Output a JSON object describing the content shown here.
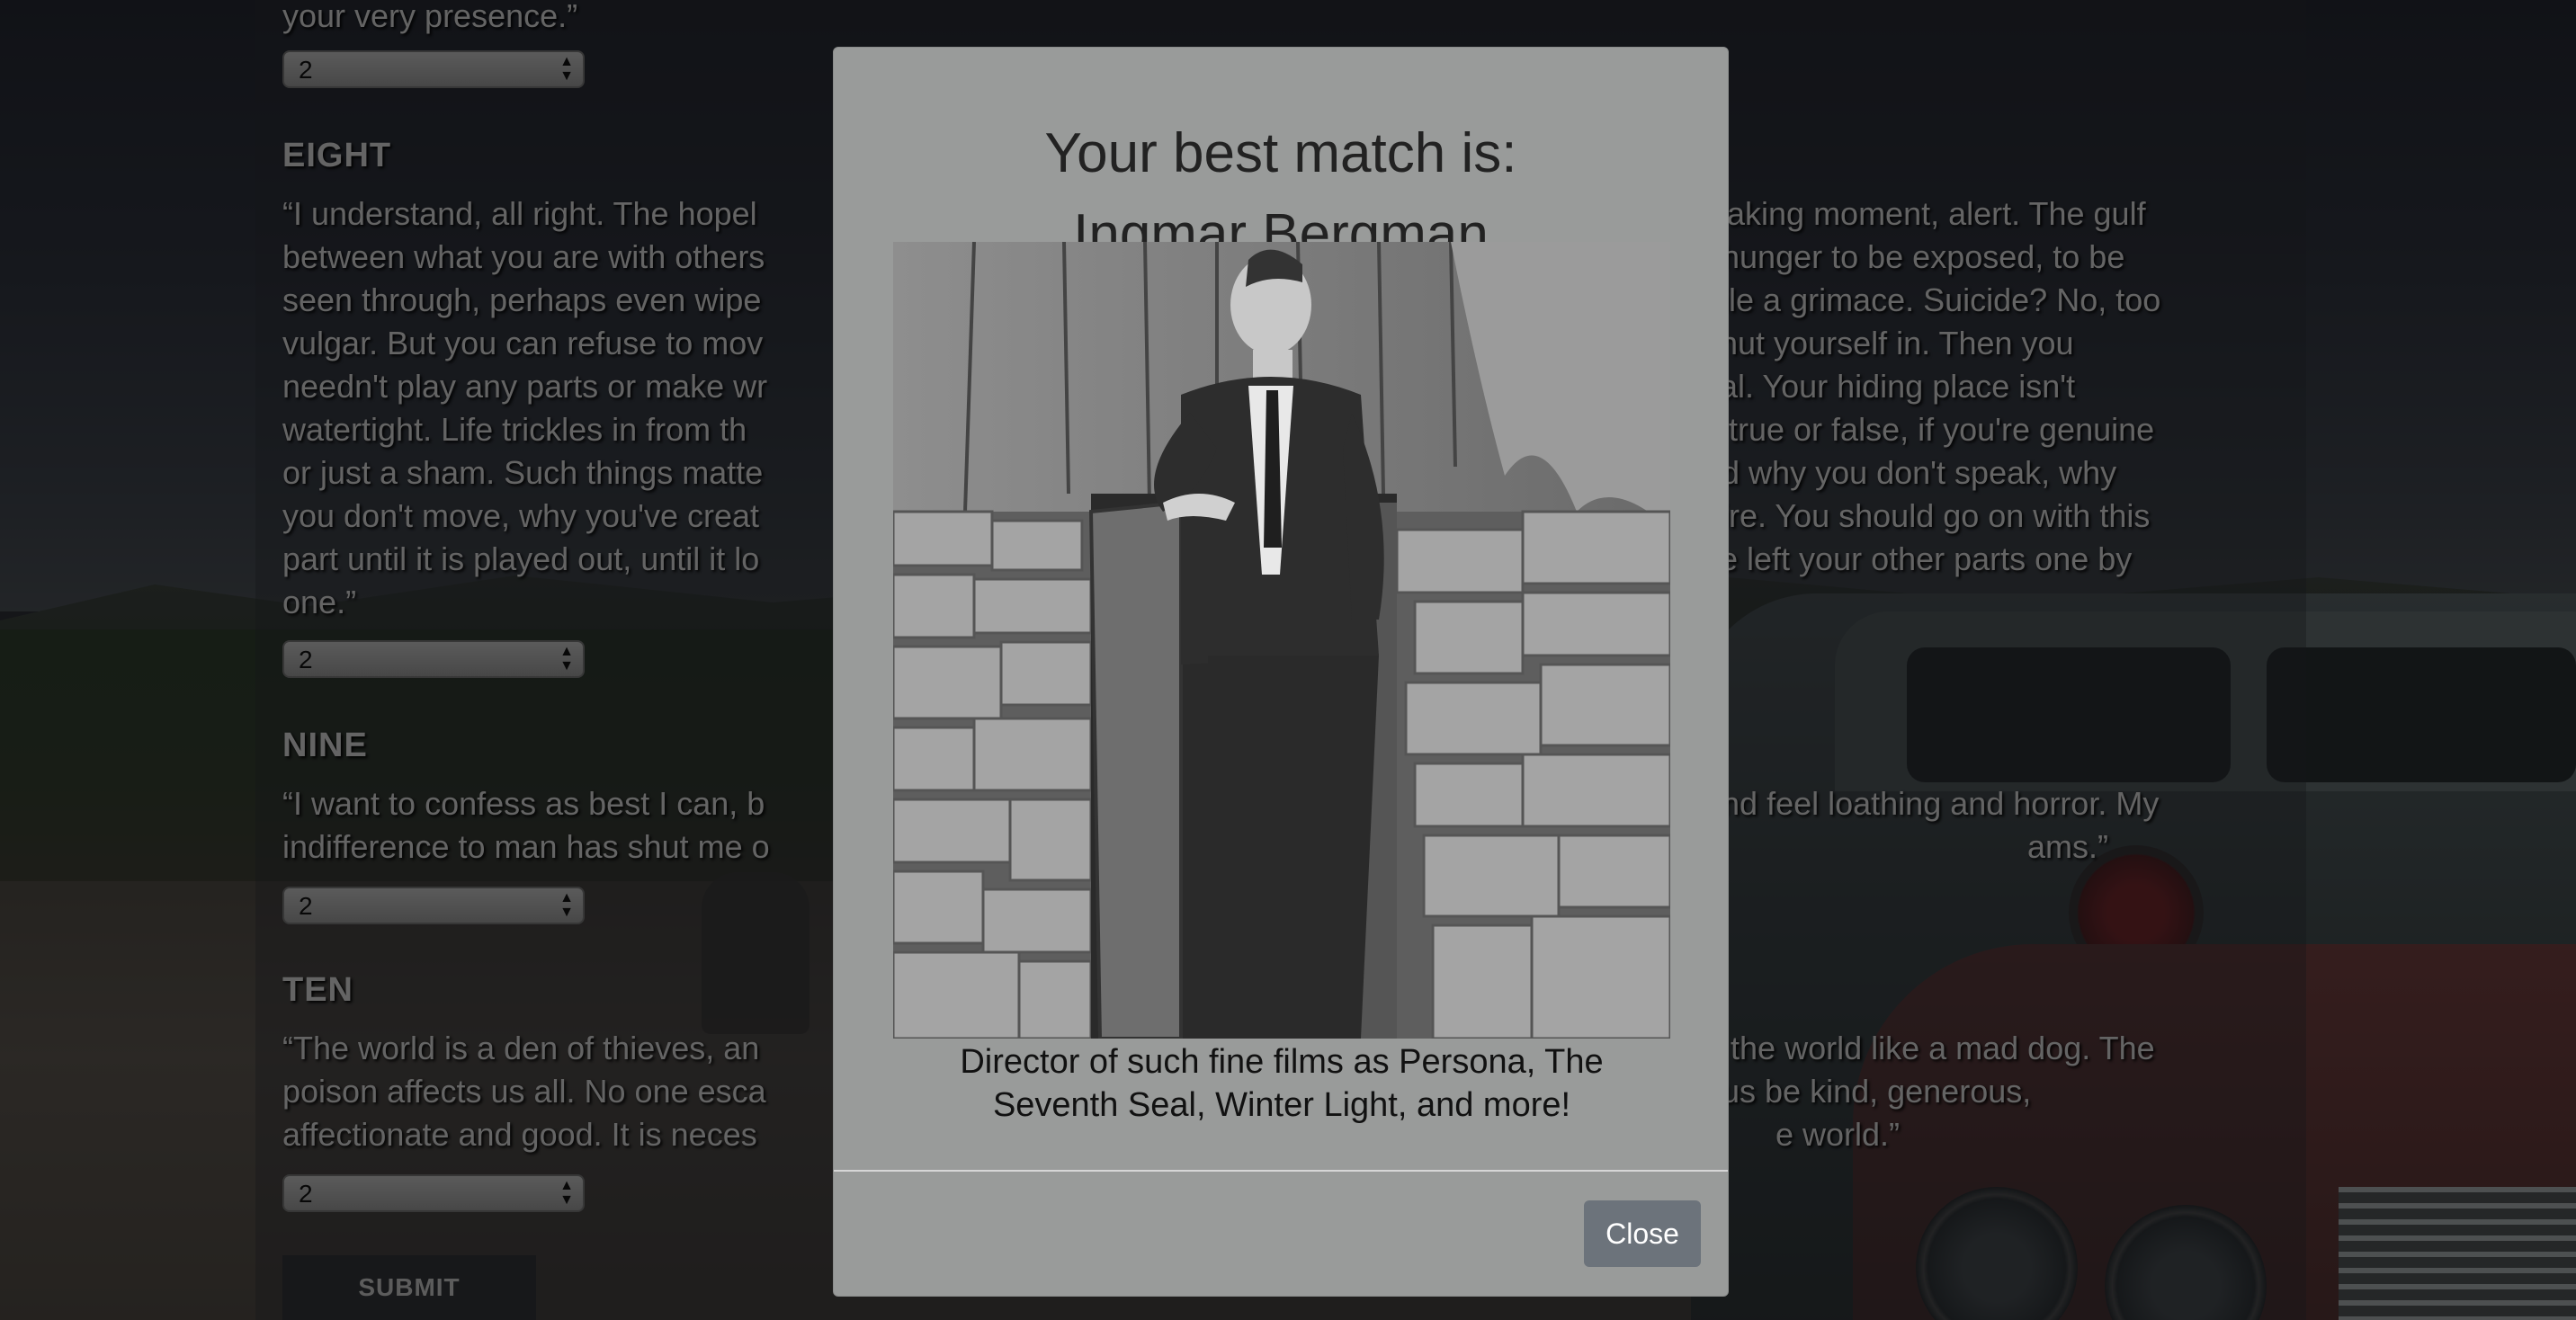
{
  "page": {
    "questions": [
      {
        "label": "",
        "text": "your very presence.”",
        "selected": "2"
      },
      {
        "label": "EIGHT",
        "text_visible": [
          "“I understand, all right. The hopel",
          "between what you are with others",
          "seen through, perhaps even wipe",
          "vulgar. But you can refuse to mov",
          "needn't play any parts or make wr",
          "watertight. Life trickles in from th",
          "or just a sham. Such things matte",
          "you don't move, why you've creat",
          "part until it is played out, until it lo",
          "one.”"
        ],
        "text_right": [
          "waking moment, alert. The gulf",
          "t hunger to be exposed, to be",
          "hile a grimace. Suicide? No, too",
          "shut yourself in. Then you",
          "cal. Your hiding place isn't",
          "s true or false, if you're genuine",
          "nd why you don't speak, why",
          "nire. You should go on with this",
          "ve left your other parts one by",
          ""
        ],
        "selected": "2"
      },
      {
        "label": "NINE",
        "text_visible": [
          "“I want to confess as best I can, b",
          "indifference to man has shut me o"
        ],
        "text_right": [
          "and feel loathing and horror. My",
          "ams.”"
        ],
        "selected": "2"
      },
      {
        "label": "TEN",
        "text_visible": [
          "“The world is a den of thieves, an",
          "poison affects us all. No one esca",
          "affectionate and good. It is neces"
        ],
        "text_right": [
          "h the world like a mad dog. The",
          "t us be kind, generous,",
          "e world.”"
        ],
        "selected": "2"
      }
    ],
    "submit_label": "SUBMIT"
  },
  "modal": {
    "title": "Your best match is:",
    "match_name": "Ingmar Bergman",
    "description_line1": "Director of such fine films as Persona, The",
    "description_line2": "Seventh Seal, Winter Light, and more!",
    "close_label": "Close"
  }
}
